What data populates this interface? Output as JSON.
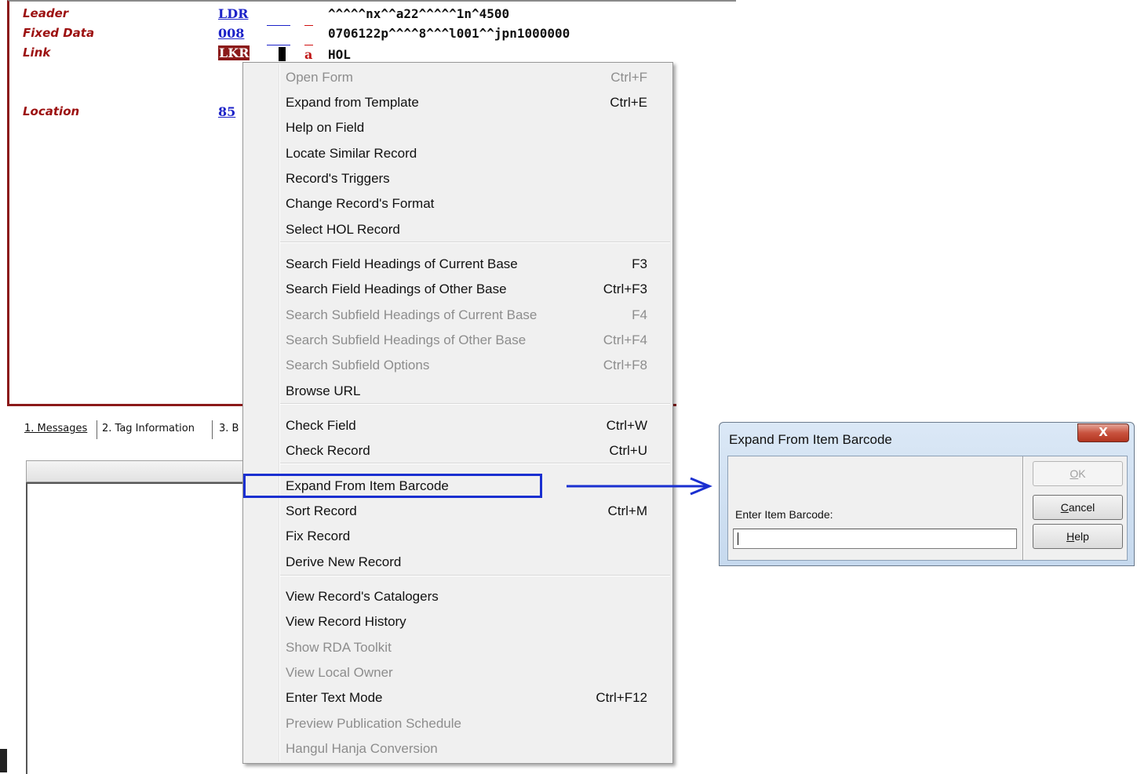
{
  "editor": {
    "fields": [
      {
        "name": "Leader",
        "tag": "LDR",
        "value": "^^^^^nx^^a22^^^^^1n^4500"
      },
      {
        "name": "Fixed Data",
        "tag": "008",
        "value": "0706122p^^^^8^^^l001^^jpn1000000"
      },
      {
        "name": "Link",
        "tag": "LKR",
        "subfield": "a",
        "value": "HOL"
      },
      {
        "name": "Location",
        "tag": "85"
      }
    ]
  },
  "tabs": [
    {
      "label": "1. Messages"
    },
    {
      "label": "2. Tag Information"
    },
    {
      "label": "3. B"
    }
  ],
  "menu": {
    "items": [
      {
        "label": "Open Form",
        "shortcut": "Ctrl+F",
        "disabled": true
      },
      {
        "label": "Expand from Template",
        "shortcut": "Ctrl+E",
        "disabled": false
      },
      {
        "label": "Help on Field",
        "shortcut": "",
        "disabled": false
      },
      {
        "label": "Locate Similar Record",
        "shortcut": "",
        "disabled": false
      },
      {
        "label": "Record's Triggers",
        "shortcut": "",
        "disabled": false
      },
      {
        "label": "Change Record's Format",
        "shortcut": "",
        "disabled": false
      },
      {
        "label": "Select HOL Record",
        "shortcut": "",
        "disabled": false
      },
      {
        "label": "Search Field Headings of Current Base",
        "shortcut": "F3",
        "disabled": false
      },
      {
        "label": "Search Field Headings of Other Base",
        "shortcut": "Ctrl+F3",
        "disabled": false
      },
      {
        "label": "Search Subfield Headings of Current Base",
        "shortcut": "F4",
        "disabled": true
      },
      {
        "label": "Search Subfield Headings of Other Base",
        "shortcut": "Ctrl+F4",
        "disabled": true
      },
      {
        "label": "Search Subfield Options",
        "shortcut": "Ctrl+F8",
        "disabled": true
      },
      {
        "label": "Browse URL",
        "shortcut": "",
        "disabled": false
      },
      {
        "label": "Check Field",
        "shortcut": "Ctrl+W",
        "disabled": false
      },
      {
        "label": "Check Record",
        "shortcut": "Ctrl+U",
        "disabled": false
      },
      {
        "label": "Expand From Item Barcode",
        "shortcut": "",
        "disabled": false
      },
      {
        "label": "Sort Record",
        "shortcut": "Ctrl+M",
        "disabled": false
      },
      {
        "label": "Fix Record",
        "shortcut": "",
        "disabled": false
      },
      {
        "label": "Derive New Record",
        "shortcut": "",
        "disabled": false
      },
      {
        "label": "View Record's Catalogers",
        "shortcut": "",
        "disabled": false
      },
      {
        "label": "View Record History",
        "shortcut": "",
        "disabled": false
      },
      {
        "label": "Show RDA Toolkit",
        "shortcut": "",
        "disabled": true
      },
      {
        "label": "View Local Owner",
        "shortcut": "",
        "disabled": true
      },
      {
        "label": "Enter Text Mode",
        "shortcut": "Ctrl+F12",
        "disabled": false
      },
      {
        "label": "Preview Publication Schedule",
        "shortcut": "",
        "disabled": true
      },
      {
        "label": "Hangul Hanja Conversion",
        "shortcut": "",
        "disabled": true
      }
    ]
  },
  "dialog": {
    "title": "Expand From Item Barcode",
    "close_glyph": "X",
    "field_label": "Enter Item Barcode:",
    "field_value": "",
    "ok": {
      "label": "OK",
      "mnemonic": "O",
      "rest": "K",
      "disabled": true
    },
    "cancel": {
      "label": "Cancel",
      "mnemonic": "C",
      "rest": "ancel",
      "disabled": false
    },
    "help": {
      "label": "Help",
      "mnemonic": "H",
      "rest": "elp",
      "disabled": false
    }
  },
  "colors": {
    "highlight_box": "#1a2fd0",
    "arrow": "#1a2fd0",
    "field_name": "#9c1010",
    "tag": "#1c22c8"
  }
}
